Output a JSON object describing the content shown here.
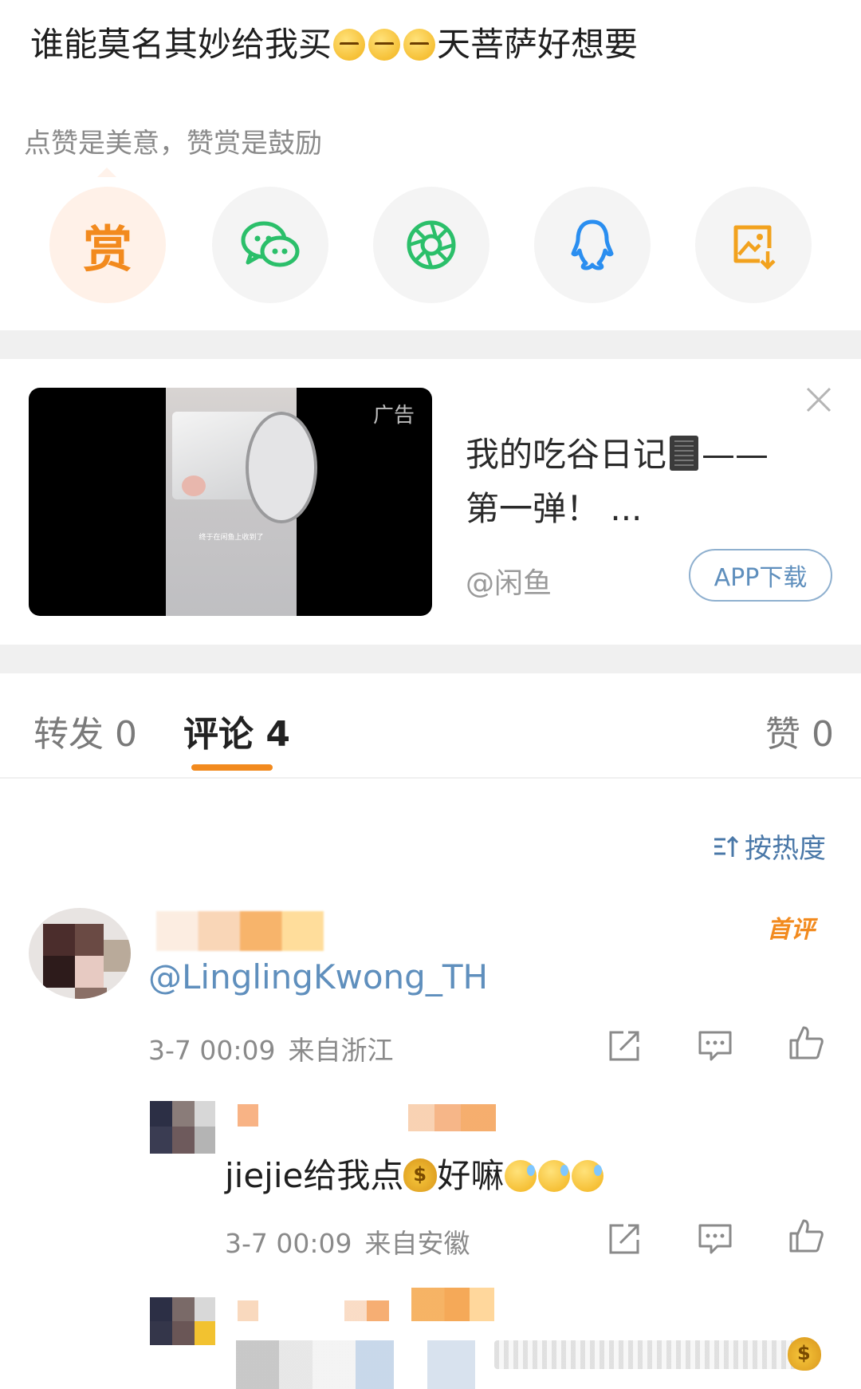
{
  "post": {
    "text_before": "谁能莫名其妙给我买",
    "text_after": "天菩萨好想要",
    "emoji_count": 3
  },
  "tip": {
    "text": "点赞是美意，赞赏是鼓励"
  },
  "share": {
    "reward_label": "赏",
    "buttons": [
      "reward-icon",
      "wechat-icon",
      "moments-icon",
      "qq-icon",
      "save-image-icon"
    ]
  },
  "ad": {
    "badge": "广告",
    "video_caption": "终于在闲鱼上收到了",
    "title_before": "我的吃谷日记",
    "title_after": "——第一弹！ ...",
    "source": "@闲鱼",
    "download_label": "APP下载"
  },
  "tabs": {
    "repost": "转发 0",
    "comments": "评论 4",
    "likes": "赞 0"
  },
  "sort": {
    "label": "按热度"
  },
  "comments": [
    {
      "username": "@LinglingKwong_TH",
      "badge": "首评",
      "date": "3-7 00:09",
      "location": "来自浙江"
    }
  ],
  "replies": [
    {
      "text_before": "jiejie给我点",
      "text_mid": "好嘛",
      "date": "3-7 00:09",
      "location": "来自安徽"
    }
  ],
  "colors": {
    "accent": "#f28a1e",
    "link": "#5f8fbd",
    "wechat": "#2bbf6a",
    "qq": "#2a8ef0",
    "save": "#f2a21e"
  }
}
